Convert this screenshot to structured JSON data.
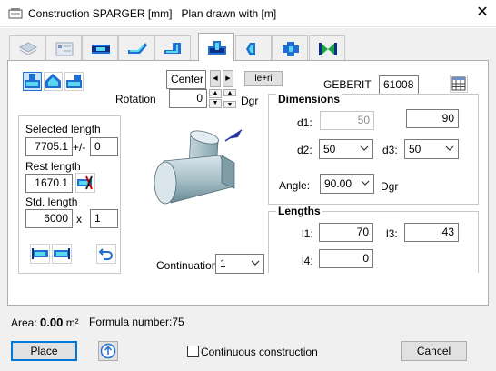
{
  "window": {
    "title": "Construction SPARGER [mm]",
    "plan_note": "Plan drawn with  [m]",
    "close_glyph": "✕"
  },
  "tabs": [
    {
      "icon": "layers-icon"
    },
    {
      "icon": "list-icon"
    },
    {
      "icon": "straight-pipe-icon"
    },
    {
      "icon": "bend-icon"
    },
    {
      "icon": "offset-bend-icon"
    },
    {
      "icon": "tee-icon",
      "active": true
    },
    {
      "icon": "reducer-icon"
    },
    {
      "icon": "cross-icon"
    },
    {
      "icon": "valve-icon"
    }
  ],
  "toolbar": {
    "position": {
      "value": "Center"
    },
    "side_button": "le+ri",
    "rotation_label": "Rotation",
    "rotation_value": "0",
    "rotation_unit": "Dgr"
  },
  "brand": {
    "name": "GEBERIT",
    "article": "61008"
  },
  "length_panel": {
    "selected_label": "Selected length",
    "selected_value": "7705.1",
    "tolerance_sep": "+/-",
    "tolerance_value": "0",
    "rest_label": "Rest length",
    "rest_value": "1670.1",
    "std_label": "Std. length",
    "std_value": "6000",
    "mult_sep": "x",
    "mult_value": "1"
  },
  "dimensions": {
    "header": "Dimensions",
    "d1_label": "d1:",
    "d1_value": "50",
    "d1b_value": "90",
    "d2_label": "d2:",
    "d2_value": "50",
    "d3_label": "d3:",
    "d3_value": "50",
    "angle_label": "Angle:",
    "angle_value": "90.00",
    "angle_unit": "Dgr"
  },
  "lengths": {
    "header": "Lengths",
    "l1_label": "l1:",
    "l1_value": "70",
    "l3_label": "l3:",
    "l3_value": "43",
    "l4_label": "l4:",
    "l4_value": "0"
  },
  "continuation": {
    "label": "Continuation",
    "value": "1"
  },
  "footer": {
    "area_label": "Area:",
    "area_value": "0.00",
    "area_unit": "m²",
    "formula_label": "Formula number:",
    "formula_value": "75",
    "place_button": "Place",
    "continuous_label": "Continuous construction",
    "cancel_button": "Cancel"
  },
  "colors": {
    "accent": "#0078d7",
    "icon_blue": "#1e6fd0",
    "selected_bg": "#cce4f7"
  }
}
